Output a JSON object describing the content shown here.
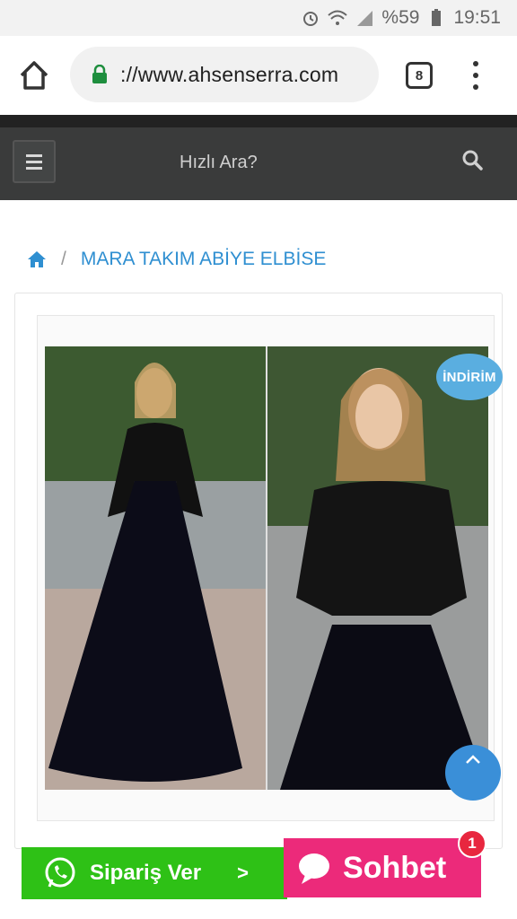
{
  "status_bar": {
    "battery": "%59",
    "time": "19:51"
  },
  "browser": {
    "url": "://www.ahsenserra.com",
    "tab_count": "8"
  },
  "header": {
    "search_placeholder": "Hızlı Ara?"
  },
  "breadcrumb": {
    "separator": "/",
    "current": "MARA TAKIM ABİYE ELBİSE"
  },
  "product": {
    "badge": "İNDİRİM"
  },
  "actions": {
    "whatsapp_label": "Sipariş Ver",
    "whatsapp_arrow": ">",
    "chat_label": "Sohbet",
    "chat_badge": "1"
  },
  "colors": {
    "header_bg": "#3a3b3b",
    "link": "#2f8fd1",
    "whatsapp": "#2ec116",
    "chat": "#ec2a7a",
    "badge": "#5aaee0"
  }
}
